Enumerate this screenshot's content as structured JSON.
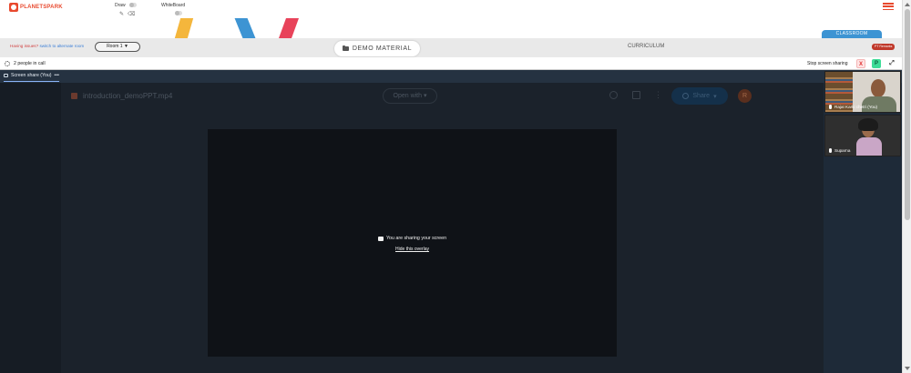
{
  "header": {
    "logo_text": "PLANETSPARK",
    "draw_label": "Draw",
    "whiteboard_label": "WhiteBoard"
  },
  "subbar": {
    "issues_text": "Having issues?",
    "switch_link": "switch to alternate room",
    "room_value": "Room 1",
    "demo_material_label": "DEMO MATERIAL",
    "curriculum_label": "CURRICULUM",
    "classroom_tab": "CLASSROOM",
    "pt_badge": "PT Remarks"
  },
  "callbar": {
    "people_count": "2 people in call",
    "stop_share_label": "Stop screen sharing",
    "x_label": "X",
    "p_label": "P",
    "expand_icon": "expand-icon"
  },
  "share": {
    "tab_label": "Screen share (You)",
    "tab_menu": "•••",
    "file_name": "introduction_demoPPT.mp4",
    "open_with": "Open with",
    "share_button": "Share",
    "avatar_initial": "R",
    "overlay_message": "You are sharing your screen",
    "hide_overlay": "Hide this overlay"
  },
  "participants": [
    {
      "name": "Rajat Karki chetri (You)"
    },
    {
      "name": "Suparna"
    }
  ],
  "colors": {
    "accent": "#e8492e",
    "classroom_blue": "#3d94d3",
    "share_panel": "#1e2a38",
    "stop_x": "#e03131",
    "p_green": "#3ddc97"
  }
}
